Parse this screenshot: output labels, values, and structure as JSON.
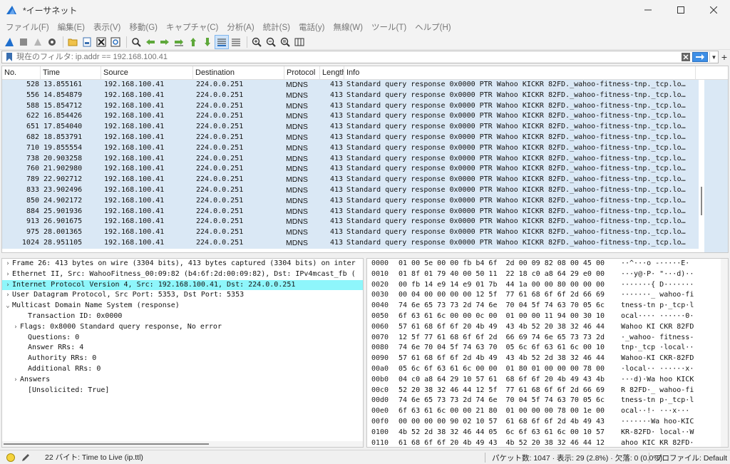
{
  "window": {
    "title": "*イーサネット",
    "controls": [
      "minimize",
      "maximize",
      "close"
    ]
  },
  "menu": [
    "ファイル(F)",
    "編集(E)",
    "表示(V)",
    "移動(G)",
    "キャプチャ(C)",
    "分析(A)",
    "統計(S)",
    "電話(y)",
    "無線(W)",
    "ツール(T)",
    "ヘルプ(H)"
  ],
  "toolbar": {
    "icons": [
      "shark-fin-icon",
      "stop-icon",
      "restart-icon",
      "options-gear-icon",
      "open-folder-icon",
      "save-file-icon",
      "close-file-icon",
      "reload-icon",
      "find-icon",
      "go-back-icon",
      "go-forward-icon",
      "go-to-packet-icon",
      "go-first-icon",
      "go-last-icon",
      "autoscroll-icon",
      "colorize-icon",
      "zoom-in-icon",
      "zoom-out-icon",
      "zoom-normal-icon",
      "resize-columns-icon"
    ]
  },
  "filter": {
    "value": "",
    "placeholder": "現在のフィルタ: ip.addr == 192.168.100.41",
    "plus": "+"
  },
  "packet_list": {
    "columns": [
      "No.",
      "Time",
      "Source",
      "Destination",
      "Protocol",
      "Length",
      "Info"
    ],
    "rows": [
      [
        "528",
        "13.855161",
        "192.168.100.41",
        "224.0.0.251",
        "MDNS",
        "413",
        "Standard query response 0x0000 PTR Wahoo KICKR 82FD._wahoo-fitness-tnp._tcp.lo…"
      ],
      [
        "556",
        "14.854879",
        "192.168.100.41",
        "224.0.0.251",
        "MDNS",
        "413",
        "Standard query response 0x0000 PTR Wahoo KICKR 82FD._wahoo-fitness-tnp._tcp.lo…"
      ],
      [
        "588",
        "15.854712",
        "192.168.100.41",
        "224.0.0.251",
        "MDNS",
        "413",
        "Standard query response 0x0000 PTR Wahoo KICKR 82FD._wahoo-fitness-tnp._tcp.lo…"
      ],
      [
        "622",
        "16.854426",
        "192.168.100.41",
        "224.0.0.251",
        "MDNS",
        "413",
        "Standard query response 0x0000 PTR Wahoo KICKR 82FD._wahoo-fitness-tnp._tcp.lo…"
      ],
      [
        "651",
        "17.854040",
        "192.168.100.41",
        "224.0.0.251",
        "MDNS",
        "413",
        "Standard query response 0x0000 PTR Wahoo KICKR 82FD._wahoo-fitness-tnp._tcp.lo…"
      ],
      [
        "682",
        "18.853791",
        "192.168.100.41",
        "224.0.0.251",
        "MDNS",
        "413",
        "Standard query response 0x0000 PTR Wahoo KICKR 82FD._wahoo-fitness-tnp._tcp.lo…"
      ],
      [
        "710",
        "19.855554",
        "192.168.100.41",
        "224.0.0.251",
        "MDNS",
        "413",
        "Standard query response 0x0000 PTR Wahoo KICKR 82FD._wahoo-fitness-tnp._tcp.lo…"
      ],
      [
        "738",
        "20.903258",
        "192.168.100.41",
        "224.0.0.251",
        "MDNS",
        "413",
        "Standard query response 0x0000 PTR Wahoo KICKR 82FD._wahoo-fitness-tnp._tcp.lo…"
      ],
      [
        "760",
        "21.902980",
        "192.168.100.41",
        "224.0.0.251",
        "MDNS",
        "413",
        "Standard query response 0x0000 PTR Wahoo KICKR 82FD._wahoo-fitness-tnp._tcp.lo…"
      ],
      [
        "789",
        "22.902712",
        "192.168.100.41",
        "224.0.0.251",
        "MDNS",
        "413",
        "Standard query response 0x0000 PTR Wahoo KICKR 82FD._wahoo-fitness-tnp._tcp.lo…"
      ],
      [
        "833",
        "23.902496",
        "192.168.100.41",
        "224.0.0.251",
        "MDNS",
        "413",
        "Standard query response 0x0000 PTR Wahoo KICKR 82FD._wahoo-fitness-tnp._tcp.lo…"
      ],
      [
        "850",
        "24.902172",
        "192.168.100.41",
        "224.0.0.251",
        "MDNS",
        "413",
        "Standard query response 0x0000 PTR Wahoo KICKR 82FD._wahoo-fitness-tnp._tcp.lo…"
      ],
      [
        "884",
        "25.901936",
        "192.168.100.41",
        "224.0.0.251",
        "MDNS",
        "413",
        "Standard query response 0x0000 PTR Wahoo KICKR 82FD._wahoo-fitness-tnp._tcp.lo…"
      ],
      [
        "913",
        "26.901675",
        "192.168.100.41",
        "224.0.0.251",
        "MDNS",
        "413",
        "Standard query response 0x0000 PTR Wahoo KICKR 82FD._wahoo-fitness-tnp._tcp.lo…"
      ],
      [
        "975",
        "28.001365",
        "192.168.100.41",
        "224.0.0.251",
        "MDNS",
        "413",
        "Standard query response 0x0000 PTR Wahoo KICKR 82FD._wahoo-fitness-tnp._tcp.lo…"
      ],
      [
        "1024",
        "28.951105",
        "192.168.100.41",
        "224.0.0.251",
        "MDNS",
        "413",
        "Standard query response 0x0000 PTR Wahoo KICKR 82FD._wahoo-fitness-tnp._tcp.lo…"
      ]
    ],
    "row_color": "#dae8f5"
  },
  "detail_tree": [
    {
      "indent": 0,
      "arrow": "›",
      "text": "Frame 26: 413 bytes on wire (3304 bits), 413 bytes captured (3304 bits) on inter",
      "highlight": false
    },
    {
      "indent": 0,
      "arrow": "›",
      "text": "Ethernet II, Src: WahooFitness_00:09:82 (b4:6f:2d:00:09:82), Dst: IPv4mcast_fb (",
      "highlight": false
    },
    {
      "indent": 0,
      "arrow": "›",
      "text": "Internet Protocol Version 4, Src: 192.168.100.41, Dst: 224.0.0.251",
      "highlight": true
    },
    {
      "indent": 0,
      "arrow": "›",
      "text": "User Datagram Protocol, Src Port: 5353, Dst Port: 5353",
      "highlight": false
    },
    {
      "indent": 0,
      "arrow": "⌄",
      "text": "Multicast Domain Name System (response)",
      "highlight": false
    },
    {
      "indent": 2,
      "arrow": "",
      "text": "Transaction ID: 0x0000",
      "highlight": false
    },
    {
      "indent": 1,
      "arrow": "›",
      "text": "Flags: 0x8000 Standard query response, No error",
      "highlight": false
    },
    {
      "indent": 2,
      "arrow": "",
      "text": "Questions: 0",
      "highlight": false
    },
    {
      "indent": 2,
      "arrow": "",
      "text": "Answer RRs: 4",
      "highlight": false
    },
    {
      "indent": 2,
      "arrow": "",
      "text": "Authority RRs: 0",
      "highlight": false
    },
    {
      "indent": 2,
      "arrow": "",
      "text": "Additional RRs: 0",
      "highlight": false
    },
    {
      "indent": 1,
      "arrow": "›",
      "text": "Answers",
      "highlight": false
    },
    {
      "indent": 2,
      "arrow": "",
      "text": "[Unsolicited: True]",
      "highlight": false
    }
  ],
  "bytes": [
    {
      "off": "0000",
      "hex": "01 00 5e 00 00 fb b4 6f  2d 00 09 82 08 00 45 00",
      "ascii": "··^···o -·····E·"
    },
    {
      "off": "0010",
      "hex": "01 8f 01 79 40 00 50 11  22 18 c0 a8 64 29 e0 00",
      "ascii": "···y@·P· \"···d)··"
    },
    {
      "off": "0020",
      "hex": "00 fb 14 e9 14 e9 01 7b  44 1a 00 00 80 00 00 00",
      "ascii": "·······{ D·······"
    },
    {
      "off": "0030",
      "hex": "00 04 00 00 00 00 12 5f  77 61 68 6f 6f 2d 66 69",
      "ascii": "·······_ wahoo-fi"
    },
    {
      "off": "0040",
      "hex": "74 6e 65 73 73 2d 74 6e  70 04 5f 74 63 70 05 6c",
      "ascii": "tness-tn p·_tcp·l"
    },
    {
      "off": "0050",
      "hex": "6f 63 61 6c 00 00 0c 00  01 00 00 11 94 00 30 10",
      "ascii": "ocal···· ······0·"
    },
    {
      "off": "0060",
      "hex": "57 61 68 6f 6f 20 4b 49  43 4b 52 20 38 32 46 44",
      "ascii": "Wahoo KI CKR 82FD"
    },
    {
      "off": "0070",
      "hex": "12 5f 77 61 68 6f 6f 2d  66 69 74 6e 65 73 73 2d",
      "ascii": "·_wahoo- fitness-"
    },
    {
      "off": "0080",
      "hex": "74 6e 70 04 5f 74 63 70  05 6c 6f 63 61 6c 00 10",
      "ascii": "tnp·_tcp ·local··"
    },
    {
      "off": "0090",
      "hex": "57 61 68 6f 6f 2d 4b 49  43 4b 52 2d 38 32 46 44",
      "ascii": "Wahoo-KI CKR-82FD"
    },
    {
      "off": "00a0",
      "hex": "05 6c 6f 63 61 6c 00 00  01 80 01 00 00 00 78 00",
      "ascii": "·local·· ······x·"
    },
    {
      "off": "00b0",
      "hex": "04 c0 a8 64 29 10 57 61  68 6f 6f 20 4b 49 43 4b",
      "ascii": "···d)·Wa hoo KICK"
    },
    {
      "off": "00c0",
      "hex": "52 20 38 32 46 44 12 5f  77 61 68 6f 6f 2d 66 69",
      "ascii": "R 82FD·_ wahoo-fi"
    },
    {
      "off": "00d0",
      "hex": "74 6e 65 73 73 2d 74 6e  70 04 5f 74 63 70 05 6c",
      "ascii": "tness-tn p·_tcp·l"
    },
    {
      "off": "00e0",
      "hex": "6f 63 61 6c 00 00 21 80  01 00 00 00 78 00 1e 00",
      "ascii": "ocal··!· ···x···"
    },
    {
      "off": "00f0",
      "hex": "00 00 00 00 90 02 10 57  61 68 6f 6f 2d 4b 49 43",
      "ascii": "·······Wa hoo-KIC"
    },
    {
      "off": "0100",
      "hex": "4b 52 2d 38 32 46 44 05  6c 6f 63 61 6c 00 10 57",
      "ascii": "KR-82FD· local··W"
    },
    {
      "off": "0110",
      "hex": "61 68 6f 6f 20 4b 49 43  4b 52 20 38 32 46 44 12",
      "ascii": "ahoo KIC KR 82FD·"
    },
    {
      "off": "0120",
      "hex": "5f 77 61 68 6f 6f 2d 66  69 74 6e 65 73 73 2d 74",
      "ascii": "_wahoo-f itness-t"
    },
    {
      "off": "0130",
      "hex": "6e 70 04 5f 74 63 70 05  6c 6f 63 61 6c 00 00 10",
      "ascii": "np·_tcp· local···"
    }
  ],
  "status": {
    "field": "22 バイト: Time to Live (ip.ttl)",
    "stats": "パケット数: 1047 · 表示: 29 (2.8%) · 欠落: 0 (0.0%)",
    "profile": "プロファイル: Default"
  }
}
